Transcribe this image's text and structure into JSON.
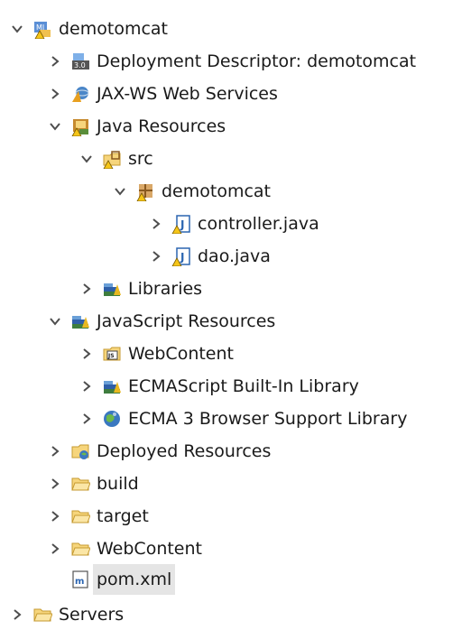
{
  "tree": {
    "items": [
      {
        "label": "demotomcat",
        "icon": "web-project-icon",
        "expanded": true
      },
      {
        "label": "Deployment Descriptor: demotomcat",
        "icon": "deployment-descriptor-icon",
        "expanded": false
      },
      {
        "label": "JAX-WS Web Services",
        "icon": "jaxws-web-services-icon",
        "expanded": false
      },
      {
        "label": "Java Resources",
        "icon": "java-resources-icon",
        "expanded": true
      },
      {
        "label": "src",
        "icon": "source-folder-icon",
        "expanded": true
      },
      {
        "label": "demotomcat",
        "icon": "package-icon",
        "expanded": true
      },
      {
        "label": "controller.java",
        "icon": "java-file-icon",
        "expanded": false
      },
      {
        "label": "dao.java",
        "icon": "java-file-icon",
        "expanded": false
      },
      {
        "label": "Libraries",
        "icon": "libraries-icon",
        "expanded": false
      },
      {
        "label": "JavaScript Resources",
        "icon": "javascript-resources-icon",
        "expanded": true
      },
      {
        "label": "WebContent",
        "icon": "js-folder-icon",
        "expanded": false
      },
      {
        "label": "ECMAScript Built-In Library",
        "icon": "libraries-icon",
        "expanded": false
      },
      {
        "label": "ECMA 3 Browser Support Library",
        "icon": "browser-library-icon",
        "expanded": false
      },
      {
        "label": "Deployed Resources",
        "icon": "deployed-resources-icon",
        "expanded": false
      },
      {
        "label": "build",
        "icon": "folder-icon",
        "expanded": false
      },
      {
        "label": "target",
        "icon": "folder-icon",
        "expanded": false
      },
      {
        "label": "WebContent",
        "icon": "folder-icon",
        "expanded": false
      },
      {
        "label": "pom.xml",
        "icon": "maven-file-icon",
        "selected": true
      },
      {
        "label": "Servers",
        "icon": "folder-icon",
        "expanded": false
      }
    ]
  },
  "colors": {
    "selection": "#e5e5e5",
    "twisty": "#4d4d4d",
    "folder": "#f7d57a",
    "java": "#2b65b1",
    "warning": "#e8b820"
  }
}
